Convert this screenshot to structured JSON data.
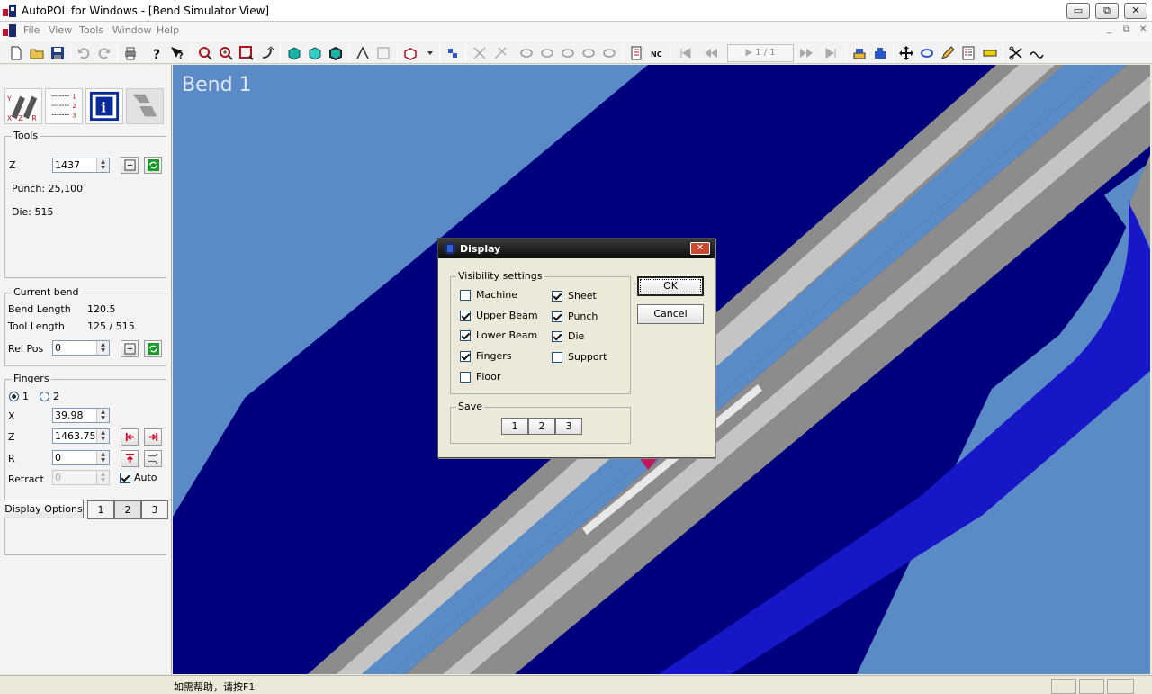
{
  "window": {
    "title": "AutoPOL for Windows - [Bend Simulator View]",
    "min_label": "▭",
    "restore_label": "⧉",
    "close_label": "✕"
  },
  "menu": {
    "items": [
      "File",
      "View",
      "Tools",
      "Window",
      "Help"
    ]
  },
  "toolbar": {
    "page_indicator": "1 / 1"
  },
  "left_panel": {
    "tools": {
      "legend": "Tools",
      "z_label": "Z",
      "z_value": "1437",
      "punch": "Punch: 25,100",
      "die": "Die: 515"
    },
    "current_bend": {
      "legend": "Current bend",
      "bend_length_label": "Bend Length",
      "bend_length_value": "120.5",
      "tool_length_label": "Tool Length",
      "tool_length_value": "125 / 515",
      "rel_pos_label": "Rel Pos",
      "rel_pos_value": "0"
    },
    "fingers": {
      "legend": "Fingers",
      "radio1": "1",
      "radio2": "2",
      "selected": "1",
      "x_label": "X",
      "x_value": "39.98",
      "z_label": "Z",
      "z_value": "1463.75",
      "r_label": "R",
      "r_value": "0",
      "retract_label": "Retract",
      "retract_value": "0",
      "auto_label": "Auto",
      "auto_checked": true
    },
    "display_options": {
      "button": "Display Options",
      "presets": [
        "1",
        "2",
        "3"
      ],
      "active_preset": "2"
    }
  },
  "viewport": {
    "bend_label": "Bend 1"
  },
  "dialog": {
    "title": "Display",
    "close_label": "✕",
    "visibility_legend": "Visibility settings",
    "left_options": [
      {
        "label": "Machine",
        "checked": false
      },
      {
        "label": "Upper Beam",
        "checked": true
      },
      {
        "label": "Lower Beam",
        "checked": true
      },
      {
        "label": "Fingers",
        "checked": true
      },
      {
        "label": "Floor",
        "checked": false
      }
    ],
    "right_options": [
      {
        "label": "Sheet",
        "checked": true
      },
      {
        "label": "Punch",
        "checked": true
      },
      {
        "label": "Die",
        "checked": true
      },
      {
        "label": "Support",
        "checked": false
      }
    ],
    "save_legend": "Save",
    "save_buttons": [
      "1",
      "2",
      "3"
    ],
    "ok_label": "OK",
    "cancel_label": "Cancel"
  },
  "status": {
    "text": "如需帮助，请按F1"
  }
}
